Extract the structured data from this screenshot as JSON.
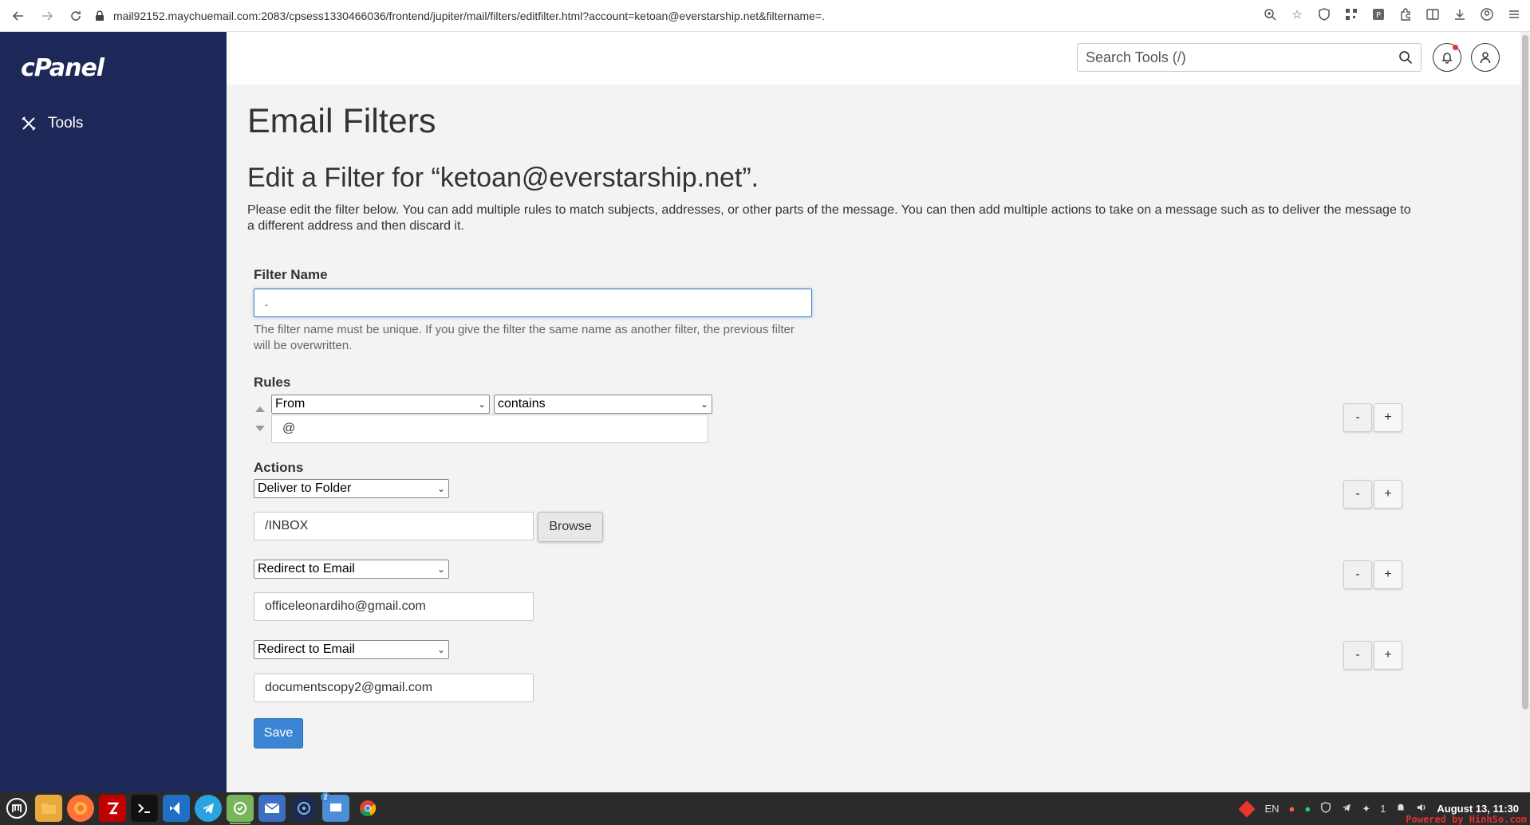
{
  "browser": {
    "url": "mail92152.maychuemail.com:2083/cpsess1330466036/frontend/jupiter/mail/filters/editfilter.html?account=ketoan@everstarship.net&filtername=."
  },
  "sidebar": {
    "logo": "cPanel",
    "items": [
      {
        "label": "Tools",
        "icon": "tools-icon"
      }
    ]
  },
  "header": {
    "search_placeholder": "Search Tools (/)"
  },
  "page": {
    "title": "Email Filters",
    "section_title": "Edit a Filter for “ketoan@everstarship.net”.",
    "description": "Please edit the filter below. You can add multiple rules to match subjects, addresses, or other parts of the message. You can then add multiple actions to take on a message such as to deliver the message to a different address and then discard it."
  },
  "filter_name": {
    "label": "Filter Name",
    "value": ".",
    "help": "The filter name must be unique. If you give the filter the same name as another filter, the previous filter will be overwritten."
  },
  "rules": {
    "label": "Rules",
    "field": "From",
    "operator": "contains",
    "value": "@"
  },
  "actions": {
    "label": "Actions",
    "items": [
      {
        "type": "Deliver to Folder",
        "value": "/INBOX",
        "browse_label": "Browse"
      },
      {
        "type": "Redirect to Email",
        "value": "officeleonardiho@gmail.com"
      },
      {
        "type": "Redirect to Email",
        "value": "documentscopy2@gmail.com"
      }
    ]
  },
  "buttons": {
    "minus": "-",
    "plus": "+",
    "save": "Save"
  },
  "taskbar": {
    "lang": "EN",
    "notif_count": "1",
    "clock": "August 13, 11:30",
    "badge": "2",
    "powered": "Powered by HinhSo.com"
  },
  "colors": {
    "sidebar": "#1e2858",
    "accent": "#3b85d4",
    "background": "#f3f3f3"
  }
}
